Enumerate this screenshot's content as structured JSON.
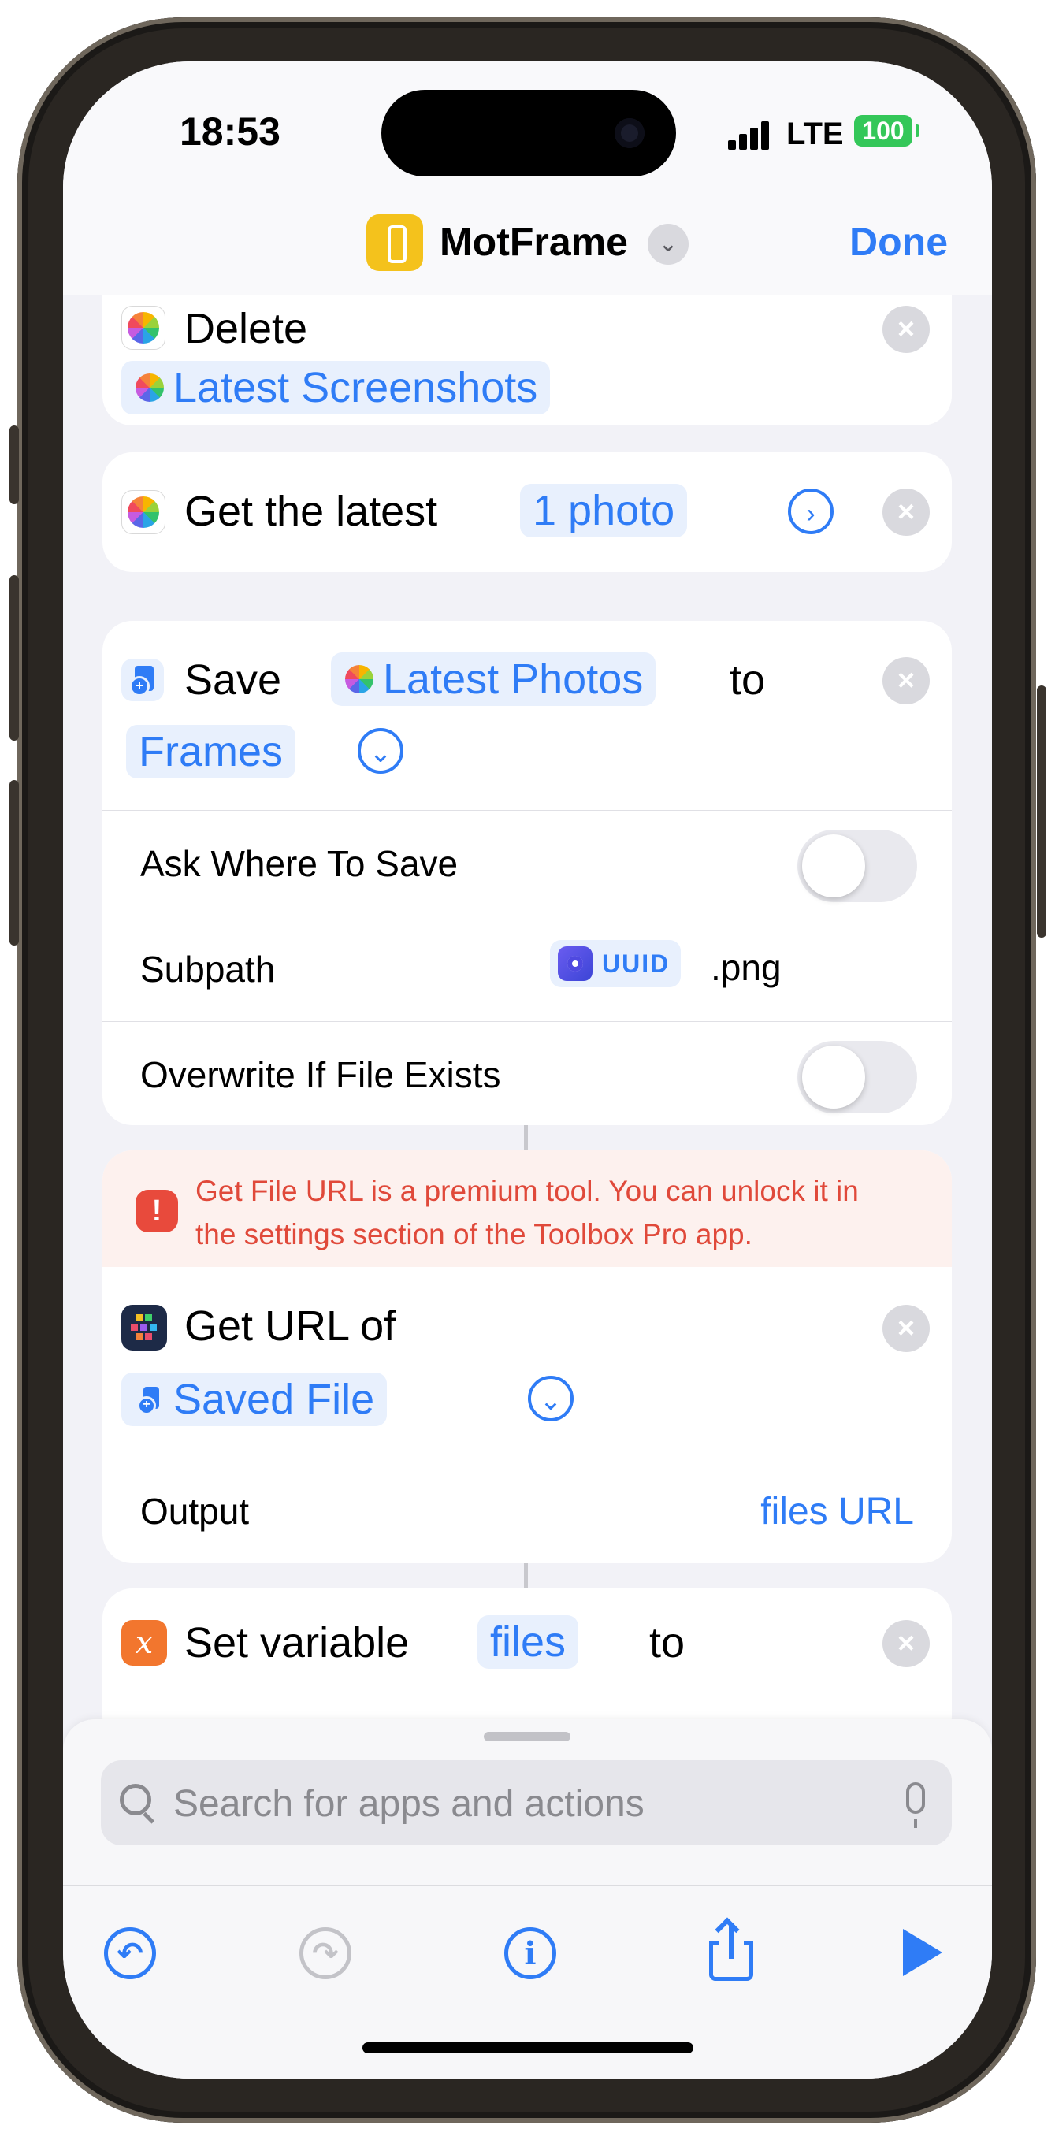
{
  "status_bar": {
    "time": "18:53",
    "network": "LTE",
    "battery": "100"
  },
  "nav": {
    "title": "MotFrame",
    "done_label": "Done"
  },
  "actions": {
    "delete": {
      "verb": "Delete",
      "target": "Latest Screenshots"
    },
    "get_latest": {
      "verb": "Get the latest",
      "count": "1 photo"
    },
    "save": {
      "verb": "Save",
      "item": "Latest Photos",
      "connector": "to",
      "destination": "Frames",
      "ask_where_label": "Ask Where To Save",
      "subpath_label": "Subpath",
      "subpath_var": "UUID",
      "subpath_suffix": ".png",
      "overwrite_label": "Overwrite If File Exists"
    },
    "get_url": {
      "warning": "Get File URL is a premium tool. You can unlock it in the settings section of the Toolbox Pro app.",
      "verb": "Get URL of",
      "source": "Saved File",
      "output_label": "Output",
      "output_value": "files URL"
    },
    "set_variable": {
      "verb": "Set variable",
      "name": "files",
      "connector": "to"
    }
  },
  "bottom_sheet": {
    "search_placeholder": "Search for apps and actions"
  },
  "colors": {
    "accent": "#2f7cf6",
    "warning": "#e0493a",
    "app_icon": "#f4c21c",
    "battery": "#34c759"
  }
}
